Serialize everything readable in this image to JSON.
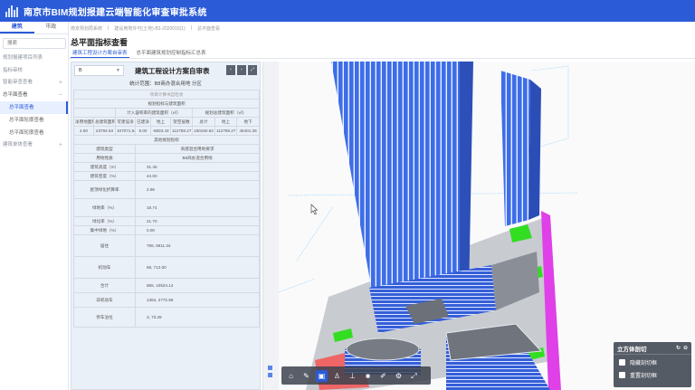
{
  "app": {
    "title": "南京市BIM规划报建云端智能化审查审批系统"
  },
  "sidebar": {
    "tabs": [
      {
        "label": "建筑"
      },
      {
        "label": "市政"
      }
    ],
    "search_placeholder": "搜索",
    "items": [
      {
        "label": "规划报建项目列表"
      },
      {
        "label": "指标审核"
      },
      {
        "label": "智能审查查看"
      },
      {
        "label": "总平面查看"
      }
    ],
    "subitems": [
      {
        "label": "总平面查看"
      },
      {
        "label": "总平面轮廓查看"
      },
      {
        "label": "总平面轮廓查看"
      }
    ],
    "last_item": {
      "label": "建筑单体查看"
    }
  },
  "breadcrumb": [
    "南京规划局系统",
    "建设用地许可(土地)-B3-2020010(1)",
    "总平面查看"
  ],
  "page": {
    "title": "总平面指标查看"
  },
  "subtabs": [
    {
      "label": "建筑工程设计方案自审表"
    },
    {
      "label": "总平面建筑规划控制指标汇总表"
    }
  ],
  "report": {
    "select_value": "B",
    "heading": "建筑工程设计方案自审表",
    "scope": "统计范围：B8商办混合用地 分区",
    "rows": [
      [
        "项目计算书自检状"
      ],
      [
        "规划指标与建筑面积"
      ],
      [
        "计入容积率的建筑面积（㎡）",
        "规划总建筑面积（㎡）"
      ],
      [
        "净用地面积",
        "总建筑面积",
        "可建设净",
        "已建净",
        "地上",
        "架空层数",
        "总计",
        "地上",
        "地下"
      ],
      [
        "4.50",
        "23794.63",
        "107071.54",
        "9.00",
        "-5603.43",
        "112759.27",
        "150160.63",
        "112759.27",
        "45401.36"
      ],
      [
        "其他规划指标"
      ],
      [
        "建筑类型",
        "商建混合用地要求"
      ],
      [
        "用地性质",
        "B8商办混合用地"
      ],
      [
        "建筑高度（m）",
        "31.45"
      ],
      [
        "建筑密度（%）",
        "44.60"
      ],
      [
        "屋顶绿化折算率",
        "2.96"
      ],
      [
        "绿地率（%）",
        "18.74"
      ],
      [
        "绿化率（%）",
        "21.70"
      ],
      [
        "集中绿地（%）",
        "0.00"
      ],
      [
        "居住",
        "786, 6611.34"
      ],
      [
        "机动车",
        "69, 712.00"
      ],
      [
        "合计",
        "855, 10524.14"
      ],
      [
        "非机动车",
        "1384, 2772.96"
      ],
      [
        "停车泊位",
        "3, 73.29"
      ]
    ]
  },
  "cut_panel": {
    "title": "立方体剖切",
    "options": [
      {
        "label": "隐藏剖切框"
      },
      {
        "label": "重置剖切框"
      }
    ]
  },
  "toolbar": {
    "tools": [
      "home-icon",
      "measure-icon",
      "cube-icon",
      "person-icon",
      "section-icon",
      "box-icon",
      "paint-icon",
      "settings-icon",
      "fullscreen-icon"
    ]
  },
  "colors": {
    "brand": "#2b5bd7",
    "building_glass": "#3f6fe6",
    "green": "#33dd22",
    "magenta": "#e040e8"
  }
}
